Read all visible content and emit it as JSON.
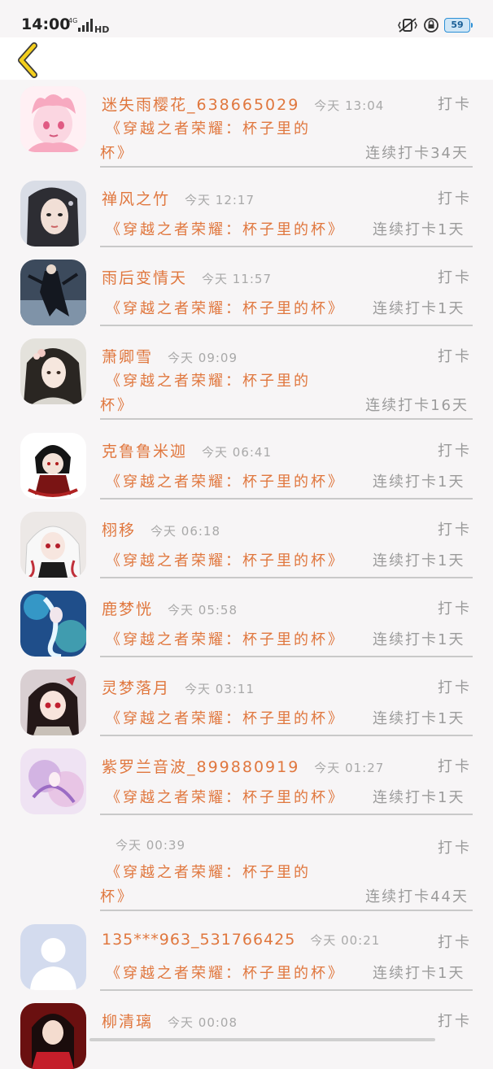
{
  "status_bar": {
    "time": "14:00",
    "network": "4G",
    "hd": "HD",
    "battery": "59"
  },
  "header": {
    "back_icon": "chevron-left-icon"
  },
  "rows": [
    {
      "name": "迷失雨樱花_638665029",
      "time": "今天 13:04",
      "checkin": "打卡",
      "title_a": "《穿越之者荣耀：杯子里的",
      "title_b": "杯》",
      "streak": "连续打卡34天",
      "avatar": "pink-haired-girl"
    },
    {
      "name": "禅风之竹",
      "time": "今天 12:17",
      "checkin": "打卡",
      "title": "《穿越之者荣耀：杯子里的杯》",
      "streak": "连续打卡1天",
      "avatar": "woman-portrait"
    },
    {
      "name": "雨后变情天",
      "time": "今天 11:57",
      "checkin": "打卡",
      "title": "《穿越之者荣耀：杯子里的杯》",
      "streak": "连续打卡1天",
      "avatar": "dark-figure"
    },
    {
      "name": "萧卿雪",
      "time": "今天 09:09",
      "checkin": "打卡",
      "title_a": "《穿越之者荣耀：杯子里的",
      "title_b": "杯》",
      "streak": "连续打卡16天",
      "avatar": "ancient-lady"
    },
    {
      "name": "克鲁鲁米迦",
      "time": "今天 06:41",
      "checkin": "打卡",
      "title": "《穿越之者荣耀：杯子里的杯》",
      "streak": "连续打卡1天",
      "avatar": "chibi-dark"
    },
    {
      "name": "栩移",
      "time": "今天 06:18",
      "checkin": "打卡",
      "title": "《穿越之者荣耀：杯子里的杯》",
      "streak": "连续打卡1天",
      "avatar": "white-hair-anime"
    },
    {
      "name": "鹿梦恍",
      "time": "今天 05:58",
      "checkin": "打卡",
      "title": "《穿越之者荣耀：杯子里的杯》",
      "streak": "连续打卡1天",
      "avatar": "blue-fantasy"
    },
    {
      "name": "灵梦落月",
      "time": "今天 03:11",
      "checkin": "打卡",
      "title": "《穿越之者荣耀：杯子里的杯》",
      "streak": "连续打卡1天",
      "avatar": "red-eyes-girl"
    },
    {
      "name": "紫罗兰音波_899880919",
      "time": "今天 01:27",
      "checkin": "打卡",
      "title": "《穿越之者荣耀：杯子里的杯》",
      "streak": "连续打卡1天",
      "avatar": "purple-fairy"
    },
    {
      "name": "",
      "time": "今天 00:39",
      "checkin": "打卡",
      "title_a": "《穿越之者荣耀：杯子里的",
      "title_b": "杯》",
      "streak": "连续打卡44天",
      "avatar": ""
    },
    {
      "name": "135***963_531766425",
      "time": "今天 00:21",
      "checkin": "打卡",
      "title": "《穿越之者荣耀：杯子里的杯》",
      "streak": "连续打卡1天",
      "avatar": "default-avatar"
    },
    {
      "name": "柳清璃",
      "time": "今天 00:08",
      "checkin": "打卡",
      "title": "",
      "streak": "",
      "avatar": "red-dress-girl"
    }
  ]
}
